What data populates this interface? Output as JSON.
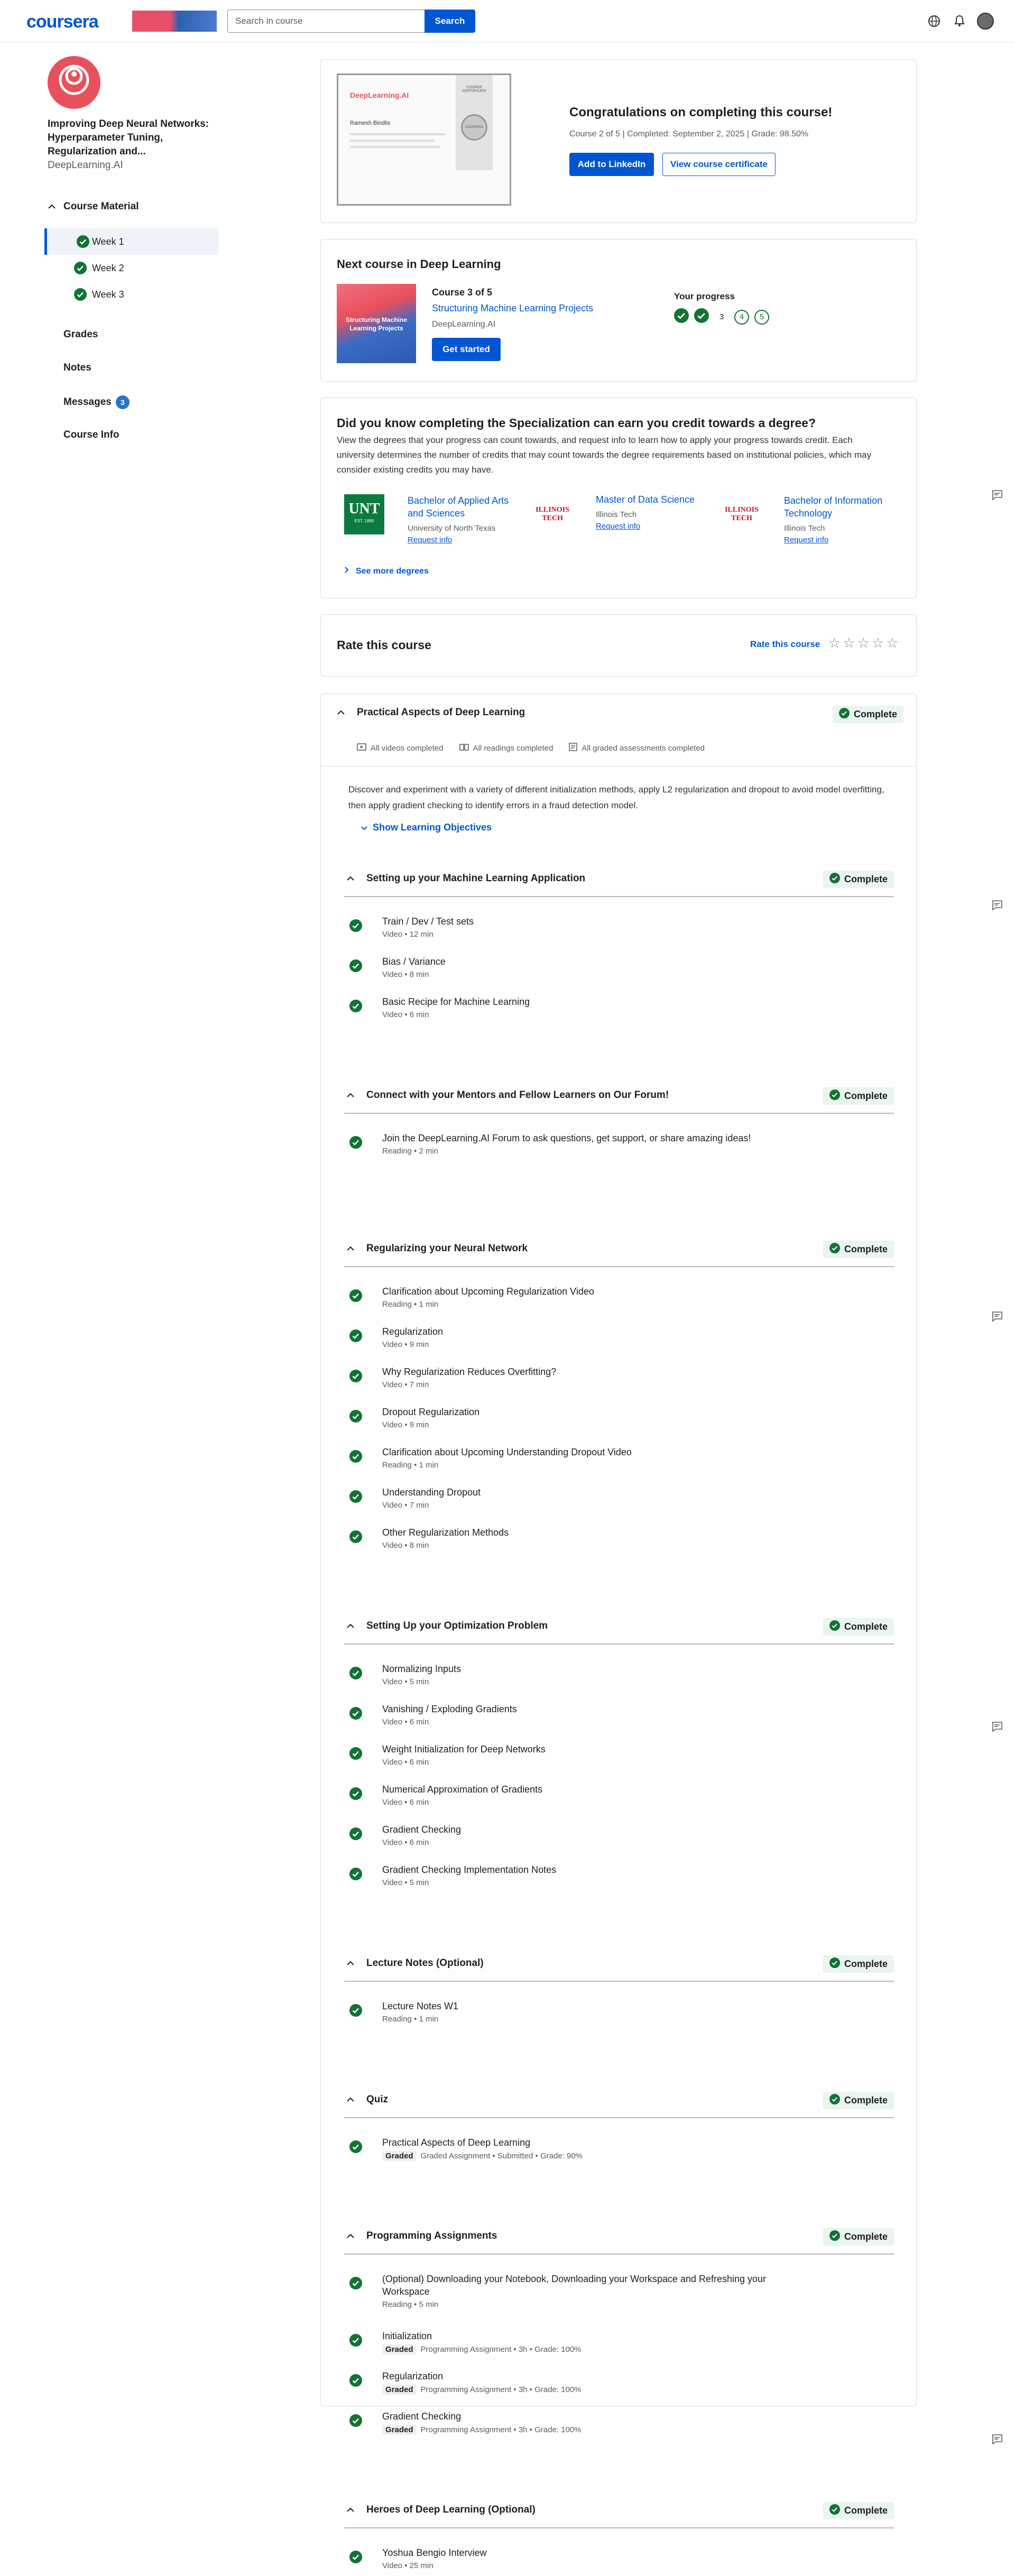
{
  "header": {
    "logo": "coursera",
    "search_placeholder": "Search in course",
    "search_button": "Search"
  },
  "sidebar": {
    "course_title": "Improving Deep Neural Networks: Hyperparameter Tuning, Regularization and...",
    "course_org": "DeepLearning.AI",
    "course_material": "Course Material",
    "weeks": [
      {
        "label": "Week 1"
      },
      {
        "label": "Week 2"
      },
      {
        "label": "Week 3"
      }
    ],
    "grades": "Grades",
    "notes": "Notes",
    "messages": "Messages",
    "messages_count": "3",
    "course_info": "Course Info"
  },
  "certificate": {
    "heading": "Congratulations on completing this course!",
    "meta": "Course 2 of 5 | Completed: September 2, 2025 | Grade: 98.50%",
    "linkedin_button": "Add to LinkedIn",
    "view_button": "View course certificate",
    "thumb_brand": "DeepLearning.AI",
    "thumb_ribbon": "COURSE CERTIFICATE",
    "thumb_name": "Ramesh Bindlis",
    "thumb_seal": "COURSERA"
  },
  "next_course": {
    "heading": "Next course in Deep Learning",
    "image_text": "Structuring Machine Learning Projects",
    "course_num": "Course 3 of 5",
    "title": "Structuring Machine Learning Projects",
    "org": "DeepLearning.AI",
    "start_button": "Get started",
    "progress_label": "Your progress",
    "progress_numbers": [
      "3",
      "4",
      "5"
    ]
  },
  "degree": {
    "heading": "Did you know completing the Specialization can earn you credit towards a degree?",
    "body": "View the degrees that your progress can count towards, and request info to learn how to apply your progress towards credit. Each university determines the number of credits that may count towards the degree requirements based on institutional policies, which may consider existing credits you may have.",
    "programs": [
      {
        "logo": "UNT",
        "logo_sub": "EST. 1890",
        "name": "Bachelor of Applied Arts and Sciences",
        "school": "University of North Texas",
        "link": "Request info"
      },
      {
        "logo": "ILLINOIS TECH",
        "name": "Master of Data Science",
        "school": "Illinois Tech",
        "link": "Request info"
      },
      {
        "logo": "ILLINOIS TECH",
        "name": "Bachelor of Information Technology",
        "school": "Illinois Tech",
        "link": "Request info"
      }
    ],
    "see_more": "See more degrees"
  },
  "rate": {
    "heading": "Rate this course",
    "link": "Rate this course",
    "stars": 5
  },
  "module": {
    "title": "Practical Aspects of Deep Learning",
    "status": "Complete",
    "stats": [
      "All videos completed",
      "All readings completed",
      "All graded assessments completed"
    ],
    "description": "Discover and experiment with a variety of different initialization methods, apply L2 regularization and dropout to avoid model overfitting, then apply gradient checking to identify errors in a fraud detection model.",
    "objectives_link": "Show Learning Objectives",
    "sections": [
      {
        "title": "Setting up your Machine Learning Application",
        "status": "Complete",
        "items": [
          {
            "title": "Train / Dev / Test sets",
            "meta": "Video • 12 min"
          },
          {
            "title": "Bias / Variance",
            "meta": "Video • 8 min"
          },
          {
            "title": "Basic Recipe for Machine Learning",
            "meta": "Video • 6 min"
          }
        ]
      },
      {
        "title": "Connect with your Mentors and Fellow Learners on Our Forum!",
        "status": "Complete",
        "items": [
          {
            "title": "Join the DeepLearning.AI Forum to ask questions, get support, or share amazing ideas!",
            "meta": "Reading • 2 min"
          }
        ]
      },
      {
        "title": "Regularizing your Neural Network",
        "status": "Complete",
        "items": [
          {
            "title": "Clarification about Upcoming Regularization Video",
            "meta": "Reading • 1 min"
          },
          {
            "title": "Regularization",
            "meta": "Video • 9 min"
          },
          {
            "title": "Why Regularization Reduces Overfitting?",
            "meta": "Video • 7 min"
          },
          {
            "title": "Dropout Regularization",
            "meta": "Video • 9 min"
          },
          {
            "title": "Clarification about Upcoming Understanding Dropout Video",
            "meta": "Reading • 1 min"
          },
          {
            "title": "Understanding Dropout",
            "meta": "Video • 7 min"
          },
          {
            "title": "Other Regularization Methods",
            "meta": "Video • 8 min"
          }
        ]
      },
      {
        "title": "Setting Up your Optimization Problem",
        "status": "Complete",
        "items": [
          {
            "title": "Normalizing Inputs",
            "meta": "Video • 5 min"
          },
          {
            "title": "Vanishing / Exploding Gradients",
            "meta": "Video • 6 min"
          },
          {
            "title": "Weight Initialization for Deep Networks",
            "meta": "Video • 6 min"
          },
          {
            "title": "Numerical Approximation of Gradients",
            "meta": "Video • 6 min"
          },
          {
            "title": "Gradient Checking",
            "meta": "Video • 6 min"
          },
          {
            "title": "Gradient Checking Implementation Notes",
            "meta": "Video • 5 min"
          }
        ]
      },
      {
        "title": "Lecture Notes (Optional)",
        "status": "Complete",
        "items": [
          {
            "title": "Lecture Notes W1",
            "meta": "Reading • 1 min"
          }
        ]
      },
      {
        "title": "Quiz",
        "status": "Complete",
        "items": [
          {
            "title": "Practical Aspects of Deep Learning",
            "graded": "Graded",
            "meta": "Graded Assignment • Submitted • Grade: 90%"
          }
        ]
      },
      {
        "title": "Programming Assignments",
        "status": "Complete",
        "items": [
          {
            "title": "(Optional) Downloading your Notebook, Downloading your Workspace and Refreshing your Workspace",
            "meta": "Reading • 5 min"
          },
          {
            "title": "Initialization",
            "graded": "Graded",
            "meta": "Programming Assignment • 3h • Grade: 100%"
          },
          {
            "title": "Regularization",
            "graded": "Graded",
            "meta": "Programming Assignment • 3h • Grade: 100%"
          },
          {
            "title": "Gradient Checking",
            "graded": "Graded",
            "meta": "Programming Assignment • 3h • Grade: 100%"
          }
        ]
      },
      {
        "title": "Heroes of Deep Learning (Optional)",
        "status": "Complete",
        "items": [
          {
            "title": "Yoshua Bengio Interview",
            "meta": "Video • 25 min"
          }
        ]
      }
    ]
  },
  "colors": {
    "brand": "#0056d2",
    "success": "#137333",
    "success_bg": "#e9f5ee"
  }
}
